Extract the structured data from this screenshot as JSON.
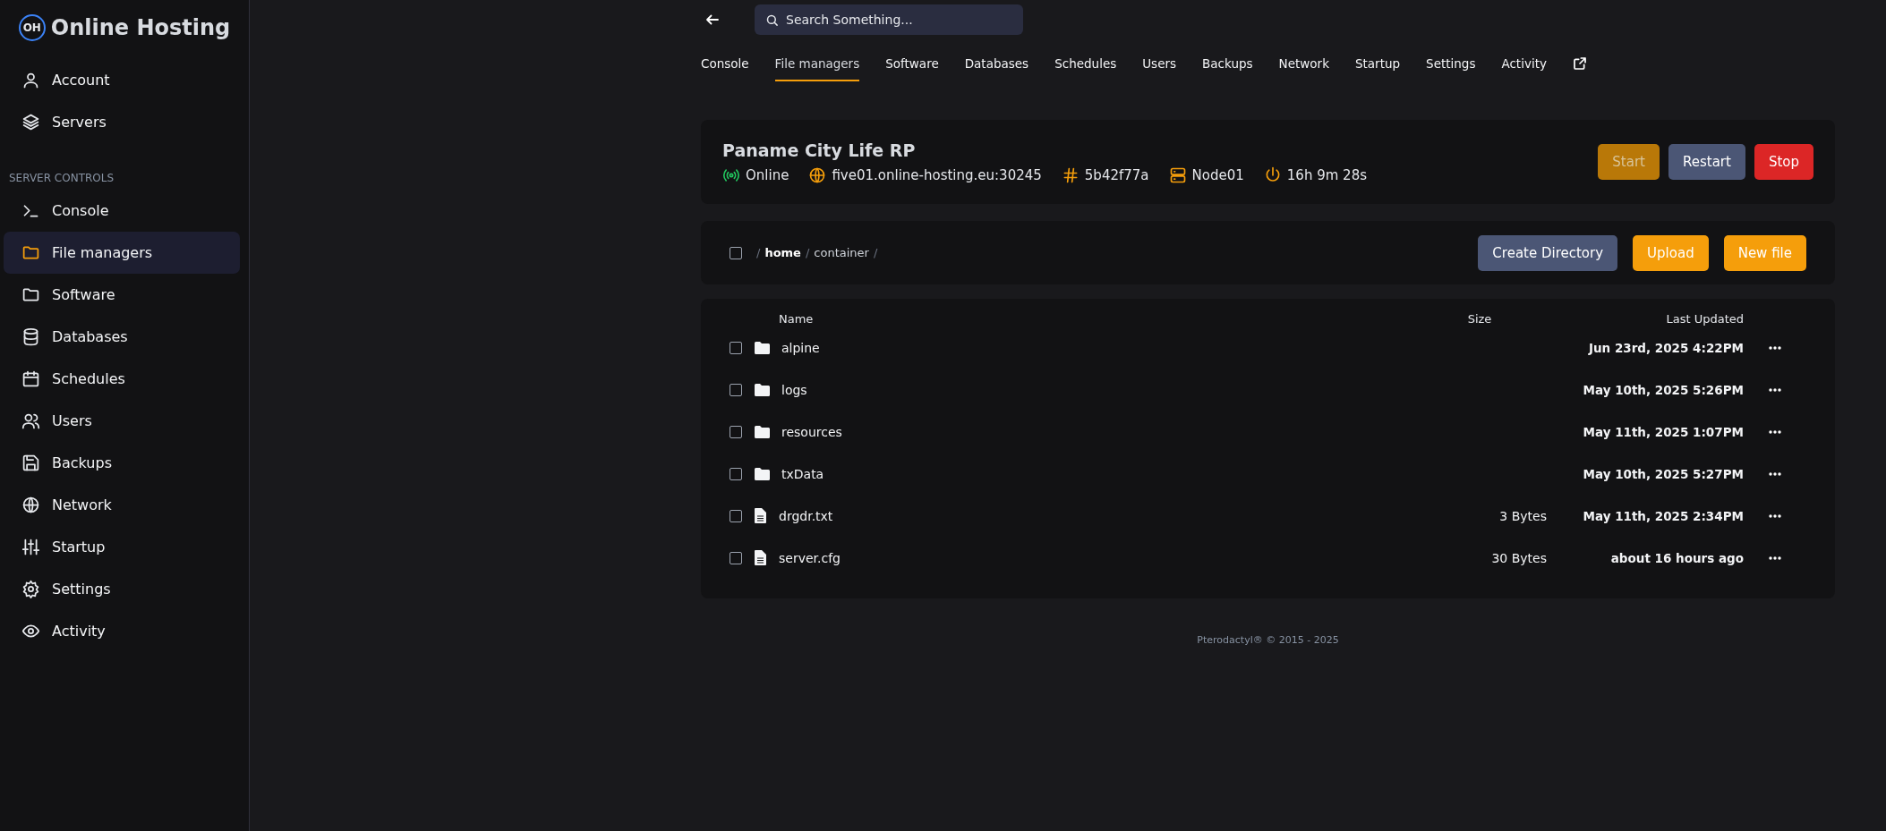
{
  "brand": {
    "name": "Online Hosting",
    "mark": "OH"
  },
  "sidebar": {
    "top_items": [
      {
        "kind": "user",
        "label": "Account",
        "selected": false
      },
      {
        "kind": "layers",
        "label": "Servers",
        "selected": false
      }
    ],
    "section_label": "SERVER CONTROLS",
    "items": [
      {
        "kind": "terminal",
        "label": "Console",
        "selected": false
      },
      {
        "kind": "folder",
        "label": "File managers",
        "selected": true
      },
      {
        "kind": "folder",
        "label": "Software",
        "selected": false
      },
      {
        "kind": "database",
        "label": "Databases",
        "selected": false
      },
      {
        "kind": "calendar",
        "label": "Schedules",
        "selected": false
      },
      {
        "kind": "users",
        "label": "Users",
        "selected": false
      },
      {
        "kind": "save",
        "label": "Backups",
        "selected": false
      },
      {
        "kind": "globe",
        "label": "Network",
        "selected": false
      },
      {
        "kind": "sliders",
        "label": "Startup",
        "selected": false
      },
      {
        "kind": "gear",
        "label": "Settings",
        "selected": false
      },
      {
        "kind": "eye",
        "label": "Activity",
        "selected": false
      }
    ]
  },
  "search": {
    "placeholder": "Search Something..."
  },
  "tabs": [
    {
      "label": "Console",
      "selected": false
    },
    {
      "label": "File managers",
      "selected": true
    },
    {
      "label": "Software",
      "selected": false
    },
    {
      "label": "Databases",
      "selected": false
    },
    {
      "label": "Schedules",
      "selected": false
    },
    {
      "label": "Users",
      "selected": false
    },
    {
      "label": "Backups",
      "selected": false
    },
    {
      "label": "Network",
      "selected": false
    },
    {
      "label": "Startup",
      "selected": false
    },
    {
      "label": "Settings",
      "selected": false
    },
    {
      "label": "Activity",
      "selected": false
    }
  ],
  "server": {
    "name": "Paname City Life RP",
    "stats": [
      {
        "kind": "signal",
        "text": "Online",
        "color": "#22c55e"
      },
      {
        "kind": "globe",
        "text": "five01.online-hosting.eu:30245",
        "color": "#f59e0b"
      },
      {
        "kind": "hash",
        "text": "5b42f77a",
        "color": "#f59e0b"
      },
      {
        "kind": "server",
        "text": "Node01",
        "color": "#f59e0b"
      },
      {
        "kind": "power",
        "text": "16h 9m 28s",
        "color": "#f59e0b"
      }
    ],
    "buttons": [
      {
        "label": "Start",
        "kind": "amber",
        "disabled": true
      },
      {
        "label": "Restart",
        "kind": "slate",
        "disabled": false
      },
      {
        "label": "Stop",
        "kind": "red",
        "disabled": false
      }
    ]
  },
  "breadcrumb": {
    "checked": false,
    "parts": [
      {
        "kind": "separator",
        "label": "/"
      },
      {
        "kind": "dir",
        "label": "home",
        "current": true
      },
      {
        "kind": "separator",
        "label": "/"
      },
      {
        "kind": "dir",
        "label": "container",
        "current": false
      },
      {
        "kind": "separator",
        "label": "/"
      }
    ]
  },
  "file_actions": [
    {
      "label": "Create Directory",
      "kind": "slate"
    },
    {
      "label": "Upload",
      "kind": "amber"
    },
    {
      "label": "New file",
      "kind": "amber"
    }
  ],
  "table": {
    "columns": [
      "Name",
      "Size",
      "Last Updated"
    ],
    "rows": [
      {
        "kind": "folder",
        "name": "alpine",
        "size": "",
        "updated": "Jun 23rd, 2025 4:22PM",
        "checked": false
      },
      {
        "kind": "folder",
        "name": "logs",
        "size": "",
        "updated": "May 10th, 2025 5:26PM",
        "checked": false
      },
      {
        "kind": "folder",
        "name": "resources",
        "size": "",
        "updated": "May 11th, 2025 1:07PM",
        "checked": false
      },
      {
        "kind": "folder",
        "name": "txData",
        "size": "",
        "updated": "May 10th, 2025 5:27PM",
        "checked": false
      },
      {
        "kind": "file",
        "name": "drgdr.txt",
        "size": "3 Bytes",
        "updated": "May 11th, 2025 2:34PM",
        "checked": false
      },
      {
        "kind": "file",
        "name": "server.cfg",
        "size": "30 Bytes",
        "updated": "about 16 hours ago",
        "checked": false
      }
    ]
  },
  "footer": "Pterodactyl® © 2015 - 2025"
}
